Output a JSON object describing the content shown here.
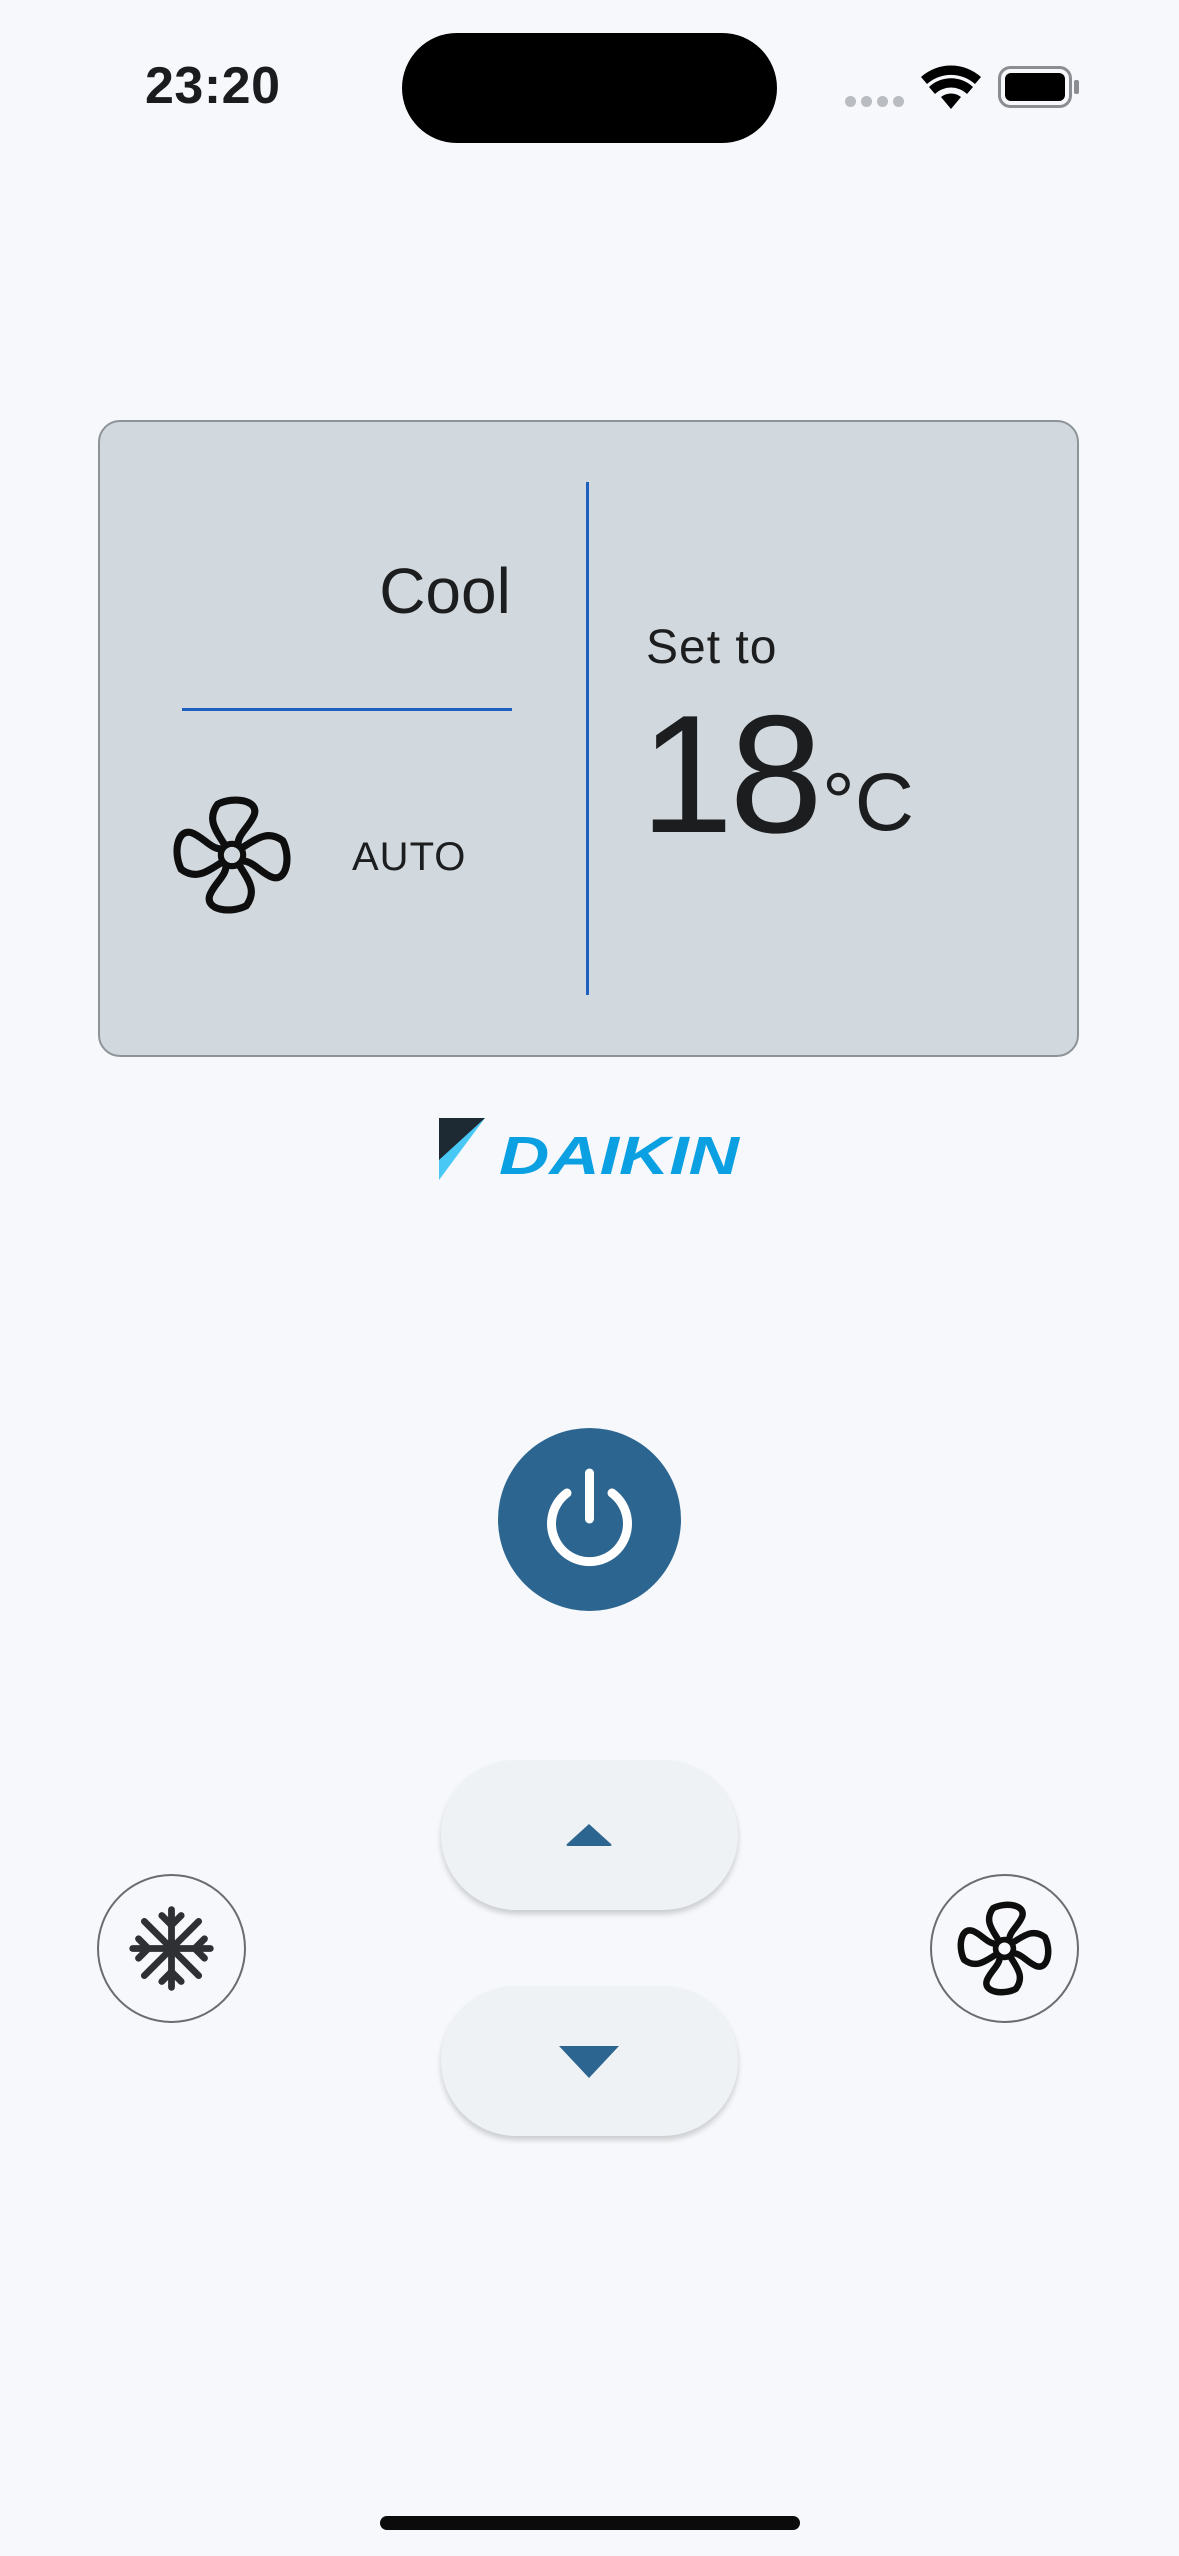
{
  "status_bar": {
    "time": "23:20",
    "icons": [
      "cellular-signal-icon",
      "wifi-icon",
      "battery-icon"
    ]
  },
  "display": {
    "mode": "Cool",
    "fan_speed": "AUTO",
    "set_to_label": "Set to",
    "temperature": "18",
    "unit": "°C",
    "fan_icon": "fan-icon"
  },
  "brand": {
    "logo_text": "DAIKIN",
    "colors": {
      "blue": "#0aa0e2",
      "light_blue": "#48c8f4",
      "dark": "#1d2a33"
    }
  },
  "controls": {
    "power_icon": "power-icon",
    "temp_up_icon": "caret-up-icon",
    "temp_down_icon": "caret-down-icon",
    "mode_icon": "snowflake-icon",
    "fan_icon": "fan-icon"
  },
  "colors": {
    "background": "#f6f8fb",
    "panel": "#d1d9de",
    "accent_line": "#1f5fc0",
    "power_button": "#2c6690",
    "arrow": "#2c6690"
  }
}
